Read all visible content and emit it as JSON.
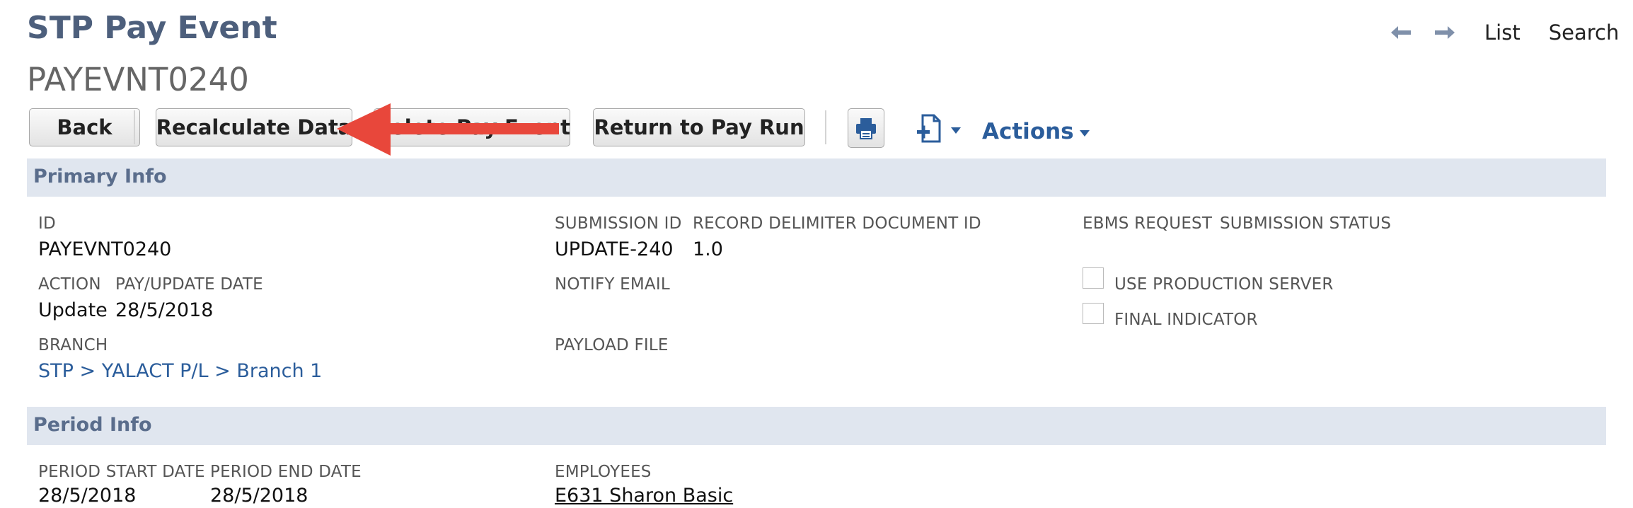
{
  "header": {
    "title": "STP Pay Event",
    "record_id": "PAYEVNT0240",
    "nav": {
      "list_label": "List",
      "search_label": "Search"
    }
  },
  "toolbar": {
    "back_label": "Back",
    "recalculate_label": "Recalculate Data",
    "delete_label": "Delete Pay Event",
    "return_label": "Return to Pay Run",
    "actions_label": "Actions"
  },
  "sections": {
    "primary": {
      "title": "Primary Info",
      "id_label": "ID",
      "id_value": "PAYEVNT0240",
      "submission_id_label": "SUBMISSION ID",
      "submission_id_value": "UPDATE-240",
      "record_delimiter_label": "RECORD DELIMITER DOCUMENT ID",
      "record_delimiter_value": "1.0",
      "ebms_request_label": "EBMS REQUEST",
      "submission_status_label": "SUBMISSION STATUS",
      "action_label": "ACTION",
      "action_value": "Update",
      "pay_update_date_label": "PAY/UPDATE DATE",
      "pay_update_date_value": "28/5/2018",
      "notify_email_label": "NOTIFY EMAIL",
      "use_production_server_label": "USE PRODUCTION SERVER",
      "final_indicator_label": "FINAL INDICATOR",
      "branch_label": "BRANCH",
      "branch_value": "STP > YALACT P/L > Branch 1",
      "payload_file_label": "PAYLOAD FILE"
    },
    "period": {
      "title": "Period Info",
      "start_label": "PERIOD START DATE",
      "start_value": "28/5/2018",
      "end_label": "PERIOD END DATE",
      "end_value": "28/5/2018",
      "employees_label": "EMPLOYEES",
      "employees_value": "E631 Sharon Basic"
    }
  },
  "icons": {
    "back_arrow": "arrow-left-icon",
    "forward_arrow": "arrow-right-icon",
    "print": "print-icon",
    "new_document": "new-document-icon",
    "annotation": "red-arrow"
  },
  "colors": {
    "title": "#4d5f7c",
    "link": "#2b5d9b",
    "band": "#e0e6ef",
    "annotation": "#e8473b"
  }
}
